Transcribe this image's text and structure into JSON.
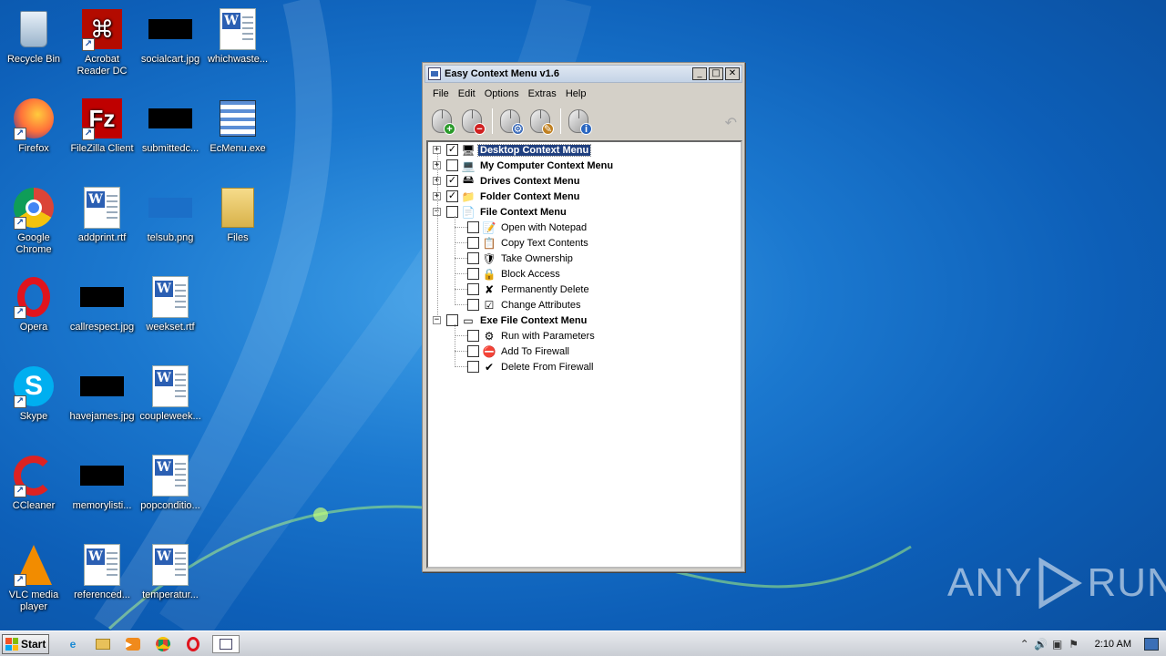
{
  "desktop": {
    "icons": [
      {
        "label": "Recycle Bin",
        "icon": "recycle-bin-icon"
      },
      {
        "label": "Acrobat Reader DC",
        "icon": "acrobat-icon"
      },
      {
        "label": "socialcart.jpg",
        "icon": "image-thumb-icon"
      },
      {
        "label": "whichwaste...",
        "icon": "word-doc-icon"
      },
      {
        "label": "Firefox",
        "icon": "firefox-icon"
      },
      {
        "label": "FileZilla Client",
        "icon": "filezilla-icon"
      },
      {
        "label": "submittedc...",
        "icon": "image-thumb-icon"
      },
      {
        "label": "EcMenu.exe",
        "icon": "ecmenu-exe-icon"
      },
      {
        "label": "Google Chrome",
        "icon": "chrome-icon"
      },
      {
        "label": "addprint.rtf",
        "icon": "word-doc-icon"
      },
      {
        "label": "telsub.png",
        "icon": "image-thumb-icon"
      },
      {
        "label": "Files",
        "icon": "folder-icon"
      },
      {
        "label": "Opera",
        "icon": "opera-icon"
      },
      {
        "label": "callrespect.jpg",
        "icon": "image-thumb-icon"
      },
      {
        "label": "weekset.rtf",
        "icon": "word-doc-icon"
      },
      {
        "label": "Skype",
        "icon": "skype-icon"
      },
      {
        "label": "havejames.jpg",
        "icon": "image-thumb-icon"
      },
      {
        "label": "coupleweek...",
        "icon": "word-doc-icon"
      },
      {
        "label": "CCleaner",
        "icon": "ccleaner-icon"
      },
      {
        "label": "memorylisti...",
        "icon": "image-thumb-icon"
      },
      {
        "label": "popconditio...",
        "icon": "word-doc-icon"
      },
      {
        "label": "VLC media player",
        "icon": "vlc-icon"
      },
      {
        "label": "referenced...",
        "icon": "word-doc-icon"
      },
      {
        "label": "temperatur...",
        "icon": "word-doc-icon"
      }
    ]
  },
  "window": {
    "title": "Easy Context Menu v1.6",
    "controls": {
      "minimize": "_",
      "maximize": "□",
      "close": "✕"
    },
    "menu": [
      "File",
      "Edit",
      "Options",
      "Extras",
      "Help"
    ],
    "toolbar": {
      "buttons": [
        {
          "name": "add-item-button",
          "badge": "+",
          "badge_color": "#2a9a2a"
        },
        {
          "name": "remove-item-button",
          "badge": "−",
          "badge_color": "#d02020"
        },
        {
          "name": "settings-button",
          "badge": "⚙",
          "badge_color": "#3a6ab8"
        },
        {
          "name": "cleaner-button",
          "badge": "✎",
          "badge_color": "#c08020"
        },
        {
          "name": "info-button",
          "badge": "i",
          "badge_color": "#2a66c0"
        }
      ],
      "undo_icon": "↶"
    },
    "tree": [
      {
        "label": "Desktop Context Menu",
        "checked": true,
        "expander": "+",
        "bold": true,
        "selected": true,
        "icon": "🖥",
        "level": 0
      },
      {
        "label": "My Computer Context Menu",
        "checked": false,
        "expander": "+",
        "bold": true,
        "selected": false,
        "icon": "💻",
        "level": 0
      },
      {
        "label": "Drives Context Menu",
        "checked": true,
        "expander": "+",
        "bold": true,
        "selected": false,
        "icon": "🖴",
        "level": 0
      },
      {
        "label": "Folder Context Menu",
        "checked": true,
        "expander": "+",
        "bold": true,
        "selected": false,
        "icon": "📁",
        "level": 0
      },
      {
        "label": "File Context Menu",
        "checked": false,
        "expander": "−",
        "bold": true,
        "selected": false,
        "icon": "📄",
        "level": 0
      },
      {
        "label": "Open with Notepad",
        "checked": false,
        "bold": false,
        "icon": "📝",
        "level": 1
      },
      {
        "label": "Copy Text Contents",
        "checked": false,
        "bold": false,
        "icon": "📋",
        "level": 1
      },
      {
        "label": "Take Ownership",
        "checked": false,
        "bold": false,
        "icon": "🛡",
        "level": 1
      },
      {
        "label": "Block Access",
        "checked": false,
        "bold": false,
        "icon": "🔒",
        "level": 1
      },
      {
        "label": "Permanently Delete",
        "checked": false,
        "bold": false,
        "icon": "✘",
        "level": 1
      },
      {
        "label": "Change Attributes",
        "checked": false,
        "bold": false,
        "icon": "☑",
        "level": 1
      },
      {
        "label": "Exe File Context Menu",
        "checked": false,
        "expander": "−",
        "bold": true,
        "selected": false,
        "icon": "▭",
        "level": 0
      },
      {
        "label": "Run with Parameters",
        "checked": false,
        "bold": false,
        "icon": "⚙",
        "level": 1
      },
      {
        "label": "Add To Firewall",
        "checked": false,
        "bold": false,
        "icon": "⛔",
        "level": 1
      },
      {
        "label": "Delete From Firewall",
        "checked": false,
        "bold": false,
        "icon": "✔",
        "level": 1
      }
    ]
  },
  "taskbar": {
    "start_label": "Start",
    "apps": [
      "ie-icon",
      "explorer-icon",
      "media-player-icon",
      "chrome-icon",
      "opera-icon",
      "ecmenu-icon"
    ],
    "clock": "2:10 AM"
  },
  "watermark": {
    "left": "ANY",
    "right": "RUN"
  }
}
